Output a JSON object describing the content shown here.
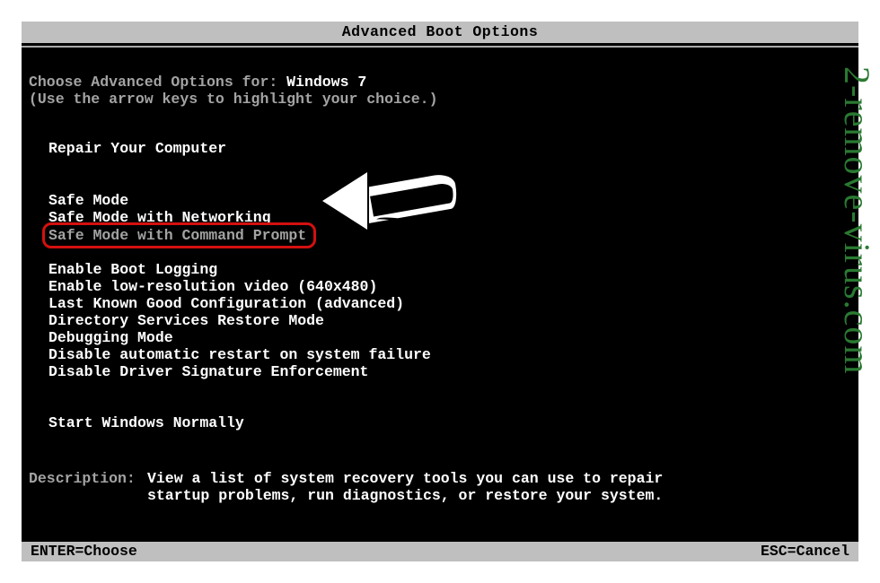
{
  "title": "Advanced Boot Options",
  "prompt": {
    "prefix": "Choose Advanced Options for: ",
    "os": "Windows 7",
    "hint": "(Use the arrow keys to highlight your choice.)"
  },
  "groups": {
    "g1": [
      "Repair Your Computer"
    ],
    "g2": [
      "Safe Mode",
      "Safe Mode with Networking"
    ],
    "highlighted": "Safe Mode with Command Prompt",
    "g3": [
      "Enable Boot Logging",
      "Enable low-resolution video (640x480)",
      "Last Known Good Configuration (advanced)",
      "Directory Services Restore Mode",
      "Debugging Mode",
      "Disable automatic restart on system failure",
      "Disable Driver Signature Enforcement"
    ],
    "g4": [
      "Start Windows Normally"
    ]
  },
  "description": {
    "label": "Description:",
    "line1": "View a list of system recovery tools you can use to repair",
    "line2": "startup problems, run diagnostics, or restore your system."
  },
  "footer": {
    "left": "ENTER=Choose",
    "right": "ESC=Cancel"
  },
  "watermark": "2-remove-virus.com"
}
